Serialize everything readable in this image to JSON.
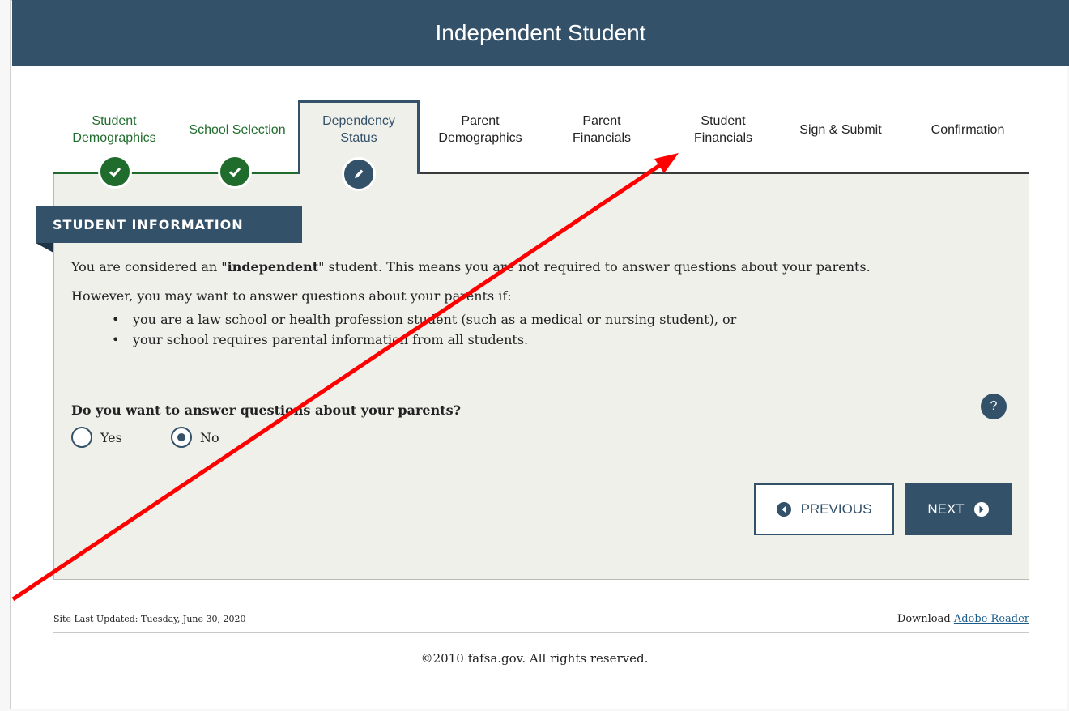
{
  "page": {
    "title": "Independent Student"
  },
  "tabs": [
    {
      "line1": "Student",
      "line2": "Demographics",
      "state": "complete"
    },
    {
      "line1": "School Selection",
      "line2": "",
      "state": "complete"
    },
    {
      "line1": "Dependency",
      "line2": "Status",
      "state": "current"
    },
    {
      "line1": "Parent",
      "line2": "Demographics",
      "state": "upcoming"
    },
    {
      "line1": "Parent",
      "line2": "Financials",
      "state": "upcoming"
    },
    {
      "line1": "Student",
      "line2": "Financials",
      "state": "upcoming"
    },
    {
      "line1": "Sign & Submit",
      "line2": "",
      "state": "upcoming"
    },
    {
      "line1": "Confirmation",
      "line2": "",
      "state": "upcoming"
    }
  ],
  "section": {
    "heading": "STUDENT INFORMATION",
    "intro_before": "You are considered an \"",
    "intro_bold": "independent",
    "intro_after": "\" student. This means you are not required to answer questions about your parents.",
    "subtext": "However, you may want to answer questions about your parents if:",
    "bullets": [
      "you are a law school or health profession student (such as a medical or nursing student), or",
      "your school requires parental information from all students."
    ],
    "question": "Do you want to answer questions about your parents?",
    "help_label": "?",
    "options": [
      {
        "label": "Yes",
        "selected": false
      },
      {
        "label": "No",
        "selected": true
      }
    ]
  },
  "buttons": {
    "previous": "PREVIOUS",
    "next": "NEXT"
  },
  "footer": {
    "updated": "Site Last Updated: Tuesday, June 30, 2020",
    "download_prefix": "Download",
    "download_link": "Adobe Reader",
    "copyright": "©2010 fafsa.gov. All rights reserved."
  },
  "colors": {
    "navy": "#34516a",
    "complete_green": "#1f6c2c",
    "annotation_red": "#ff0000"
  },
  "icons": {
    "complete": "check-icon",
    "current": "pencil-icon"
  }
}
